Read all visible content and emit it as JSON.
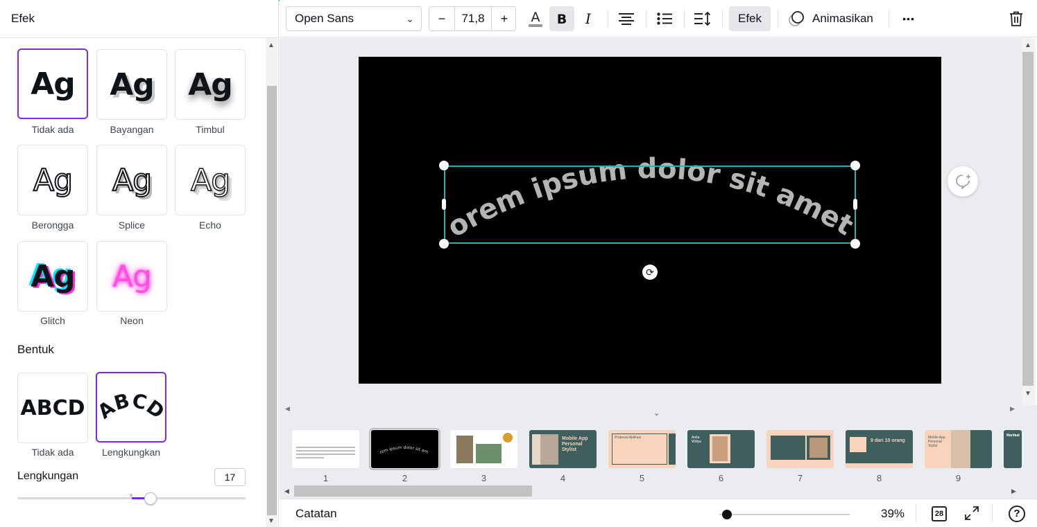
{
  "left_panel": {
    "title": "Efek",
    "effects": [
      {
        "label": "Tidak ada",
        "sample": "Ag"
      },
      {
        "label": "Bayangan",
        "sample": "Ag"
      },
      {
        "label": "Timbul",
        "sample": "Ag"
      },
      {
        "label": "Berongga",
        "sample": "Ag"
      },
      {
        "label": "Splice",
        "sample": "Ag"
      },
      {
        "label": "Echo",
        "sample": "Ag"
      },
      {
        "label": "Glitch",
        "sample": "Ag"
      },
      {
        "label": "Neon",
        "sample": "Ag"
      }
    ],
    "shape_section_title": "Bentuk",
    "shapes": [
      {
        "label": "Tidak ada",
        "sample": "ABCD"
      },
      {
        "label": "Lengkungkan",
        "sample": "ABCD"
      }
    ],
    "curve_label": "Lengkungan",
    "curve_value": "17"
  },
  "toolbar": {
    "font_name": "Open Sans",
    "font_size": "71,8",
    "minus": "−",
    "plus": "+",
    "efek_label": "Efek",
    "animate_label": "Animasikan",
    "more": "•••"
  },
  "canvas": {
    "text": "Lorem ipsum dolor sit amet,"
  },
  "thumbnails": {
    "pages": [
      "1",
      "2",
      "3",
      "4",
      "5",
      "6",
      "7",
      "8",
      "9"
    ],
    "t4_title": "Mobile App Personal Stylist",
    "t5_title": "Proposal Aplikasi",
    "t6_title": "Anita Widya",
    "t8_title": "9 dari 10 orang",
    "t9_title": "Mobile App Personal Stylist",
    "t10_title": "Manfaat",
    "t2_text": "Lorem ipsum dolor sit amet,"
  },
  "bottombar": {
    "notes_label": "Catatan",
    "zoom": "39%",
    "page_count": "28",
    "help": "?"
  },
  "colors": {
    "accent_purple": "#7d2ae8",
    "selection_teal": "#1fb5b5",
    "teal_dark": "#3f5e5e",
    "peach": "#f9d4bd"
  }
}
